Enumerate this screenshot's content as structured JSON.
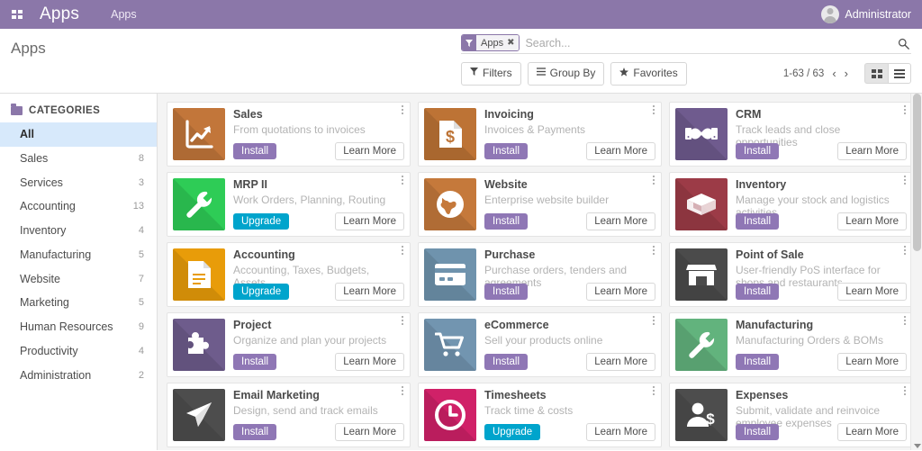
{
  "navbar": {
    "apps_grid_icon": "grid-icon",
    "brand": "Apps",
    "breadcrumb": "Apps",
    "user": "Administrator",
    "avatar_icon": "avatar-icon",
    "bg_color": "#8b77a9"
  },
  "control_panel": {
    "page_title": "Apps",
    "search": {
      "facet_label": "Apps",
      "facet_icon": "filter-icon",
      "facet_remove_icon": "close-icon",
      "placeholder": "Search...",
      "value": "",
      "search_icon": "search-icon"
    },
    "buttons": [
      {
        "label": "Filters",
        "icon": "filter-icon"
      },
      {
        "label": "Group By",
        "icon": "bars-icon"
      },
      {
        "label": "Favorites",
        "icon": "star-icon"
      }
    ],
    "pager": {
      "range": "1-63 / 63",
      "prev_icon": "chevron-left-icon",
      "next_icon": "chevron-right-icon"
    },
    "views": [
      {
        "name": "kanban-view",
        "icon": "grid-icon",
        "active": true
      },
      {
        "name": "list-view",
        "icon": "list-icon",
        "active": false
      }
    ]
  },
  "sidebar": {
    "title": "CATEGORIES",
    "title_icon": "folder-icon",
    "items": [
      {
        "label": "All",
        "count": "",
        "active": true
      },
      {
        "label": "Sales",
        "count": "8",
        "active": false
      },
      {
        "label": "Services",
        "count": "3",
        "active": false
      },
      {
        "label": "Accounting",
        "count": "13",
        "active": false
      },
      {
        "label": "Inventory",
        "count": "4",
        "active": false
      },
      {
        "label": "Manufacturing",
        "count": "5",
        "active": false
      },
      {
        "label": "Website",
        "count": "7",
        "active": false
      },
      {
        "label": "Marketing",
        "count": "5",
        "active": false
      },
      {
        "label": "Human Resources",
        "count": "9",
        "active": false
      },
      {
        "label": "Productivity",
        "count": "4",
        "active": false
      },
      {
        "label": "Administration",
        "count": "2",
        "active": false
      }
    ]
  },
  "apps": {
    "learn_more_label": "Learn More",
    "install_label": "Install",
    "upgrade_label": "Upgrade",
    "menu_icon": "kebab-menu-icon",
    "items": [
      {
        "name": "Sales",
        "desc": "From quotations to invoices",
        "action": "Install",
        "action_type": "install",
        "icon": "chart-growth-icon",
        "color": "#c2763a"
      },
      {
        "name": "Invoicing",
        "desc": "Invoices & Payments",
        "action": "Install",
        "action_type": "install",
        "icon": "invoice-dollar-icon",
        "color": "#bd7335"
      },
      {
        "name": "CRM",
        "desc": "Track leads and close opportunities",
        "action": "Install",
        "action_type": "install",
        "icon": "handshake-icon",
        "color": "#6f5b8e"
      },
      {
        "name": "MRP II",
        "desc": "Work Orders, Planning, Routing",
        "action": "Upgrade",
        "action_type": "upgrade",
        "icon": "wrench-icon",
        "color": "#2ecc56"
      },
      {
        "name": "Website",
        "desc": "Enterprise website builder",
        "action": "Install",
        "action_type": "install",
        "icon": "globe-icon",
        "color": "#c5793b"
      },
      {
        "name": "Inventory",
        "desc": "Manage your stock and logistics activities",
        "action": "Install",
        "action_type": "install",
        "icon": "open-box-icon",
        "color": "#9c3b47"
      },
      {
        "name": "Accounting",
        "desc": "Accounting, Taxes, Budgets, Assets...",
        "action": "Upgrade",
        "action_type": "upgrade",
        "icon": "document-lines-icon",
        "color": "#e89c09"
      },
      {
        "name": "Purchase",
        "desc": "Purchase orders, tenders and agreements",
        "action": "Install",
        "action_type": "install",
        "icon": "credit-card-icon",
        "color": "#6f93ad"
      },
      {
        "name": "Point of Sale",
        "desc": "User-friendly PoS interface for shops and restaurants",
        "action": "Install",
        "action_type": "install",
        "icon": "storefront-icon",
        "color": "#4b4b4b"
      },
      {
        "name": "Project",
        "desc": "Organize and plan your projects",
        "action": "Install",
        "action_type": "install",
        "icon": "puzzle-piece-icon",
        "color": "#6e5c8c"
      },
      {
        "name": "eCommerce",
        "desc": "Sell your products online",
        "action": "Install",
        "action_type": "install",
        "icon": "shopping-cart-icon",
        "color": "#7295b0"
      },
      {
        "name": "Manufacturing",
        "desc": "Manufacturing Orders & BOMs",
        "action": "Install",
        "action_type": "install",
        "icon": "wrench-icon",
        "color": "#62b37d"
      },
      {
        "name": "Email Marketing",
        "desc": "Design, send and track emails",
        "action": "Install",
        "action_type": "install",
        "icon": "paper-plane-icon",
        "color": "#4d4d4d"
      },
      {
        "name": "Timesheets",
        "desc": "Track time & costs",
        "action": "Upgrade",
        "action_type": "upgrade",
        "icon": "clock-icon",
        "color": "#d02168"
      },
      {
        "name": "Expenses",
        "desc": "Submit, validate and reinvoice employee expenses",
        "action": "Install",
        "action_type": "install",
        "icon": "user-dollar-icon",
        "color": "#4d4d4d"
      }
    ]
  }
}
